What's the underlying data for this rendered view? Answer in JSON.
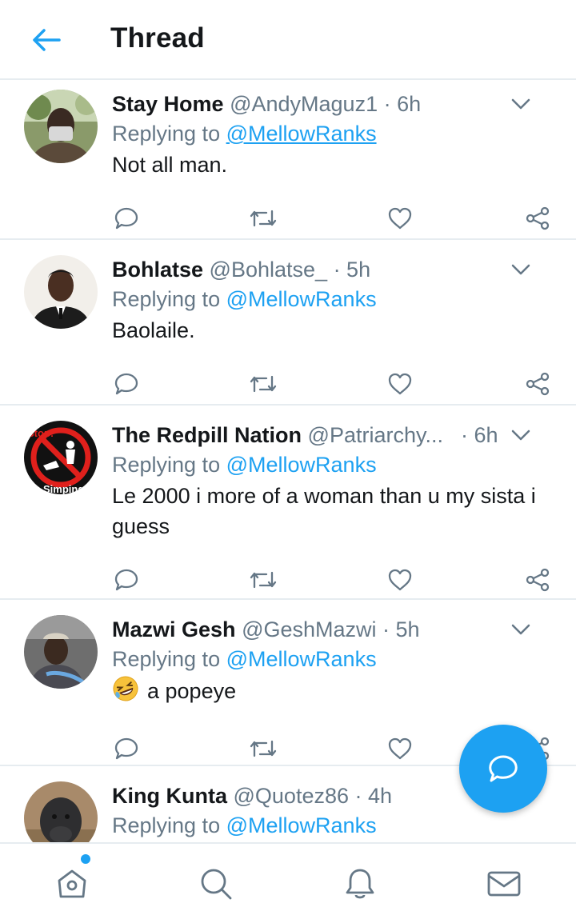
{
  "header": {
    "title": "Thread"
  },
  "colors": {
    "accent": "#1da1f2",
    "secondary_text": "#657786",
    "divider": "#e6ecf0"
  },
  "tweets": [
    {
      "name": "Stay Home",
      "handle": "@AndyMaguz1",
      "time": "· 6h",
      "replying_label": "Replying to",
      "replying_to": "@MellowRanks",
      "text": "Not all man."
    },
    {
      "name": "Bohlatse",
      "handle": "@Bohlatse_",
      "time": "· 5h",
      "replying_label": "Replying to",
      "replying_to": "@MellowRanks",
      "text": "Baolaile."
    },
    {
      "name": "The Redpill Nation",
      "handle": "@Patriarchy...",
      "time": "· 6h",
      "replying_label": "Replying to",
      "replying_to": "@MellowRanks",
      "text": "Le 2000 i more of a woman than u my sista i guess",
      "avatar_text": {
        "top": "Stop!",
        "bottom": "Simping"
      }
    },
    {
      "name": "Mazwi Gesh",
      "handle": "@GeshMazwi",
      "time": "· 5h",
      "replying_label": "Replying to",
      "replying_to": "@MellowRanks",
      "text": "a popeye",
      "emoji": "rolling-on-the-floor-laughing"
    },
    {
      "name": "King Kunta",
      "handle": "@Quotez86",
      "time": "· 4h",
      "replying_label": "Replying to",
      "replying_to": "@MellowRanks",
      "text": ""
    }
  ],
  "icons": {
    "back": "arrow-left-icon",
    "more": "chevron-down-icon",
    "reply": "reply-icon",
    "retweet": "retweet-icon",
    "like": "heart-icon",
    "share": "share-icon",
    "compose": "compose-reply-icon",
    "tabs": [
      "home-icon",
      "search-icon",
      "notifications-icon",
      "messages-icon"
    ]
  },
  "tabbar": {
    "home_has_new": true
  }
}
